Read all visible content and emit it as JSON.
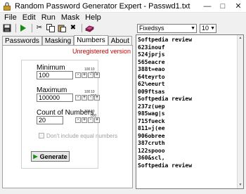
{
  "window": {
    "title": "Random Password Generator Expert - Passwd1.txt"
  },
  "menu": {
    "items": [
      "File",
      "Edit",
      "Run",
      "Mask",
      "Help"
    ]
  },
  "toolbar": {
    "buttons": [
      "save-icon",
      "run-icon",
      "cut-icon",
      "copy-icon",
      "paste-icon",
      "delete-icon",
      "book-icon"
    ],
    "font_name": "Fixedsys",
    "font_size": "10"
  },
  "tabs": [
    "Passwords",
    "Masking",
    "Numbers",
    "About"
  ],
  "active_tab": "Numbers",
  "numbers_panel": {
    "unregistered": "Unregistered version",
    "minimum": {
      "label": "Minimum",
      "value": "100"
    },
    "maximum": {
      "label": "Maximum",
      "value": "100000"
    },
    "count": {
      "label": "Count of Numbers",
      "value": "20"
    },
    "scale_labels": [
      "100",
      "10 000"
    ],
    "no_equal_label": "Don't include equal numbers",
    "generate_label": "Generate"
  },
  "editor": {
    "lines": [
      "Softpedia review",
      "623inouf",
      "524jprjs",
      "565eacre",
      "388t=eao",
      "64teyrto",
      "62%eeurt",
      "009ftsas",
      "Softpedia review",
      "237z(uep",
      "985wag|s",
      "715fueck",
      "811=j(ee",
      "906obree",
      "387cruth",
      "122spooo",
      "360&scl,",
      "Softpedia review"
    ]
  },
  "colors": {
    "unregistered": "#d00000",
    "lock": "#c89a2a"
  }
}
